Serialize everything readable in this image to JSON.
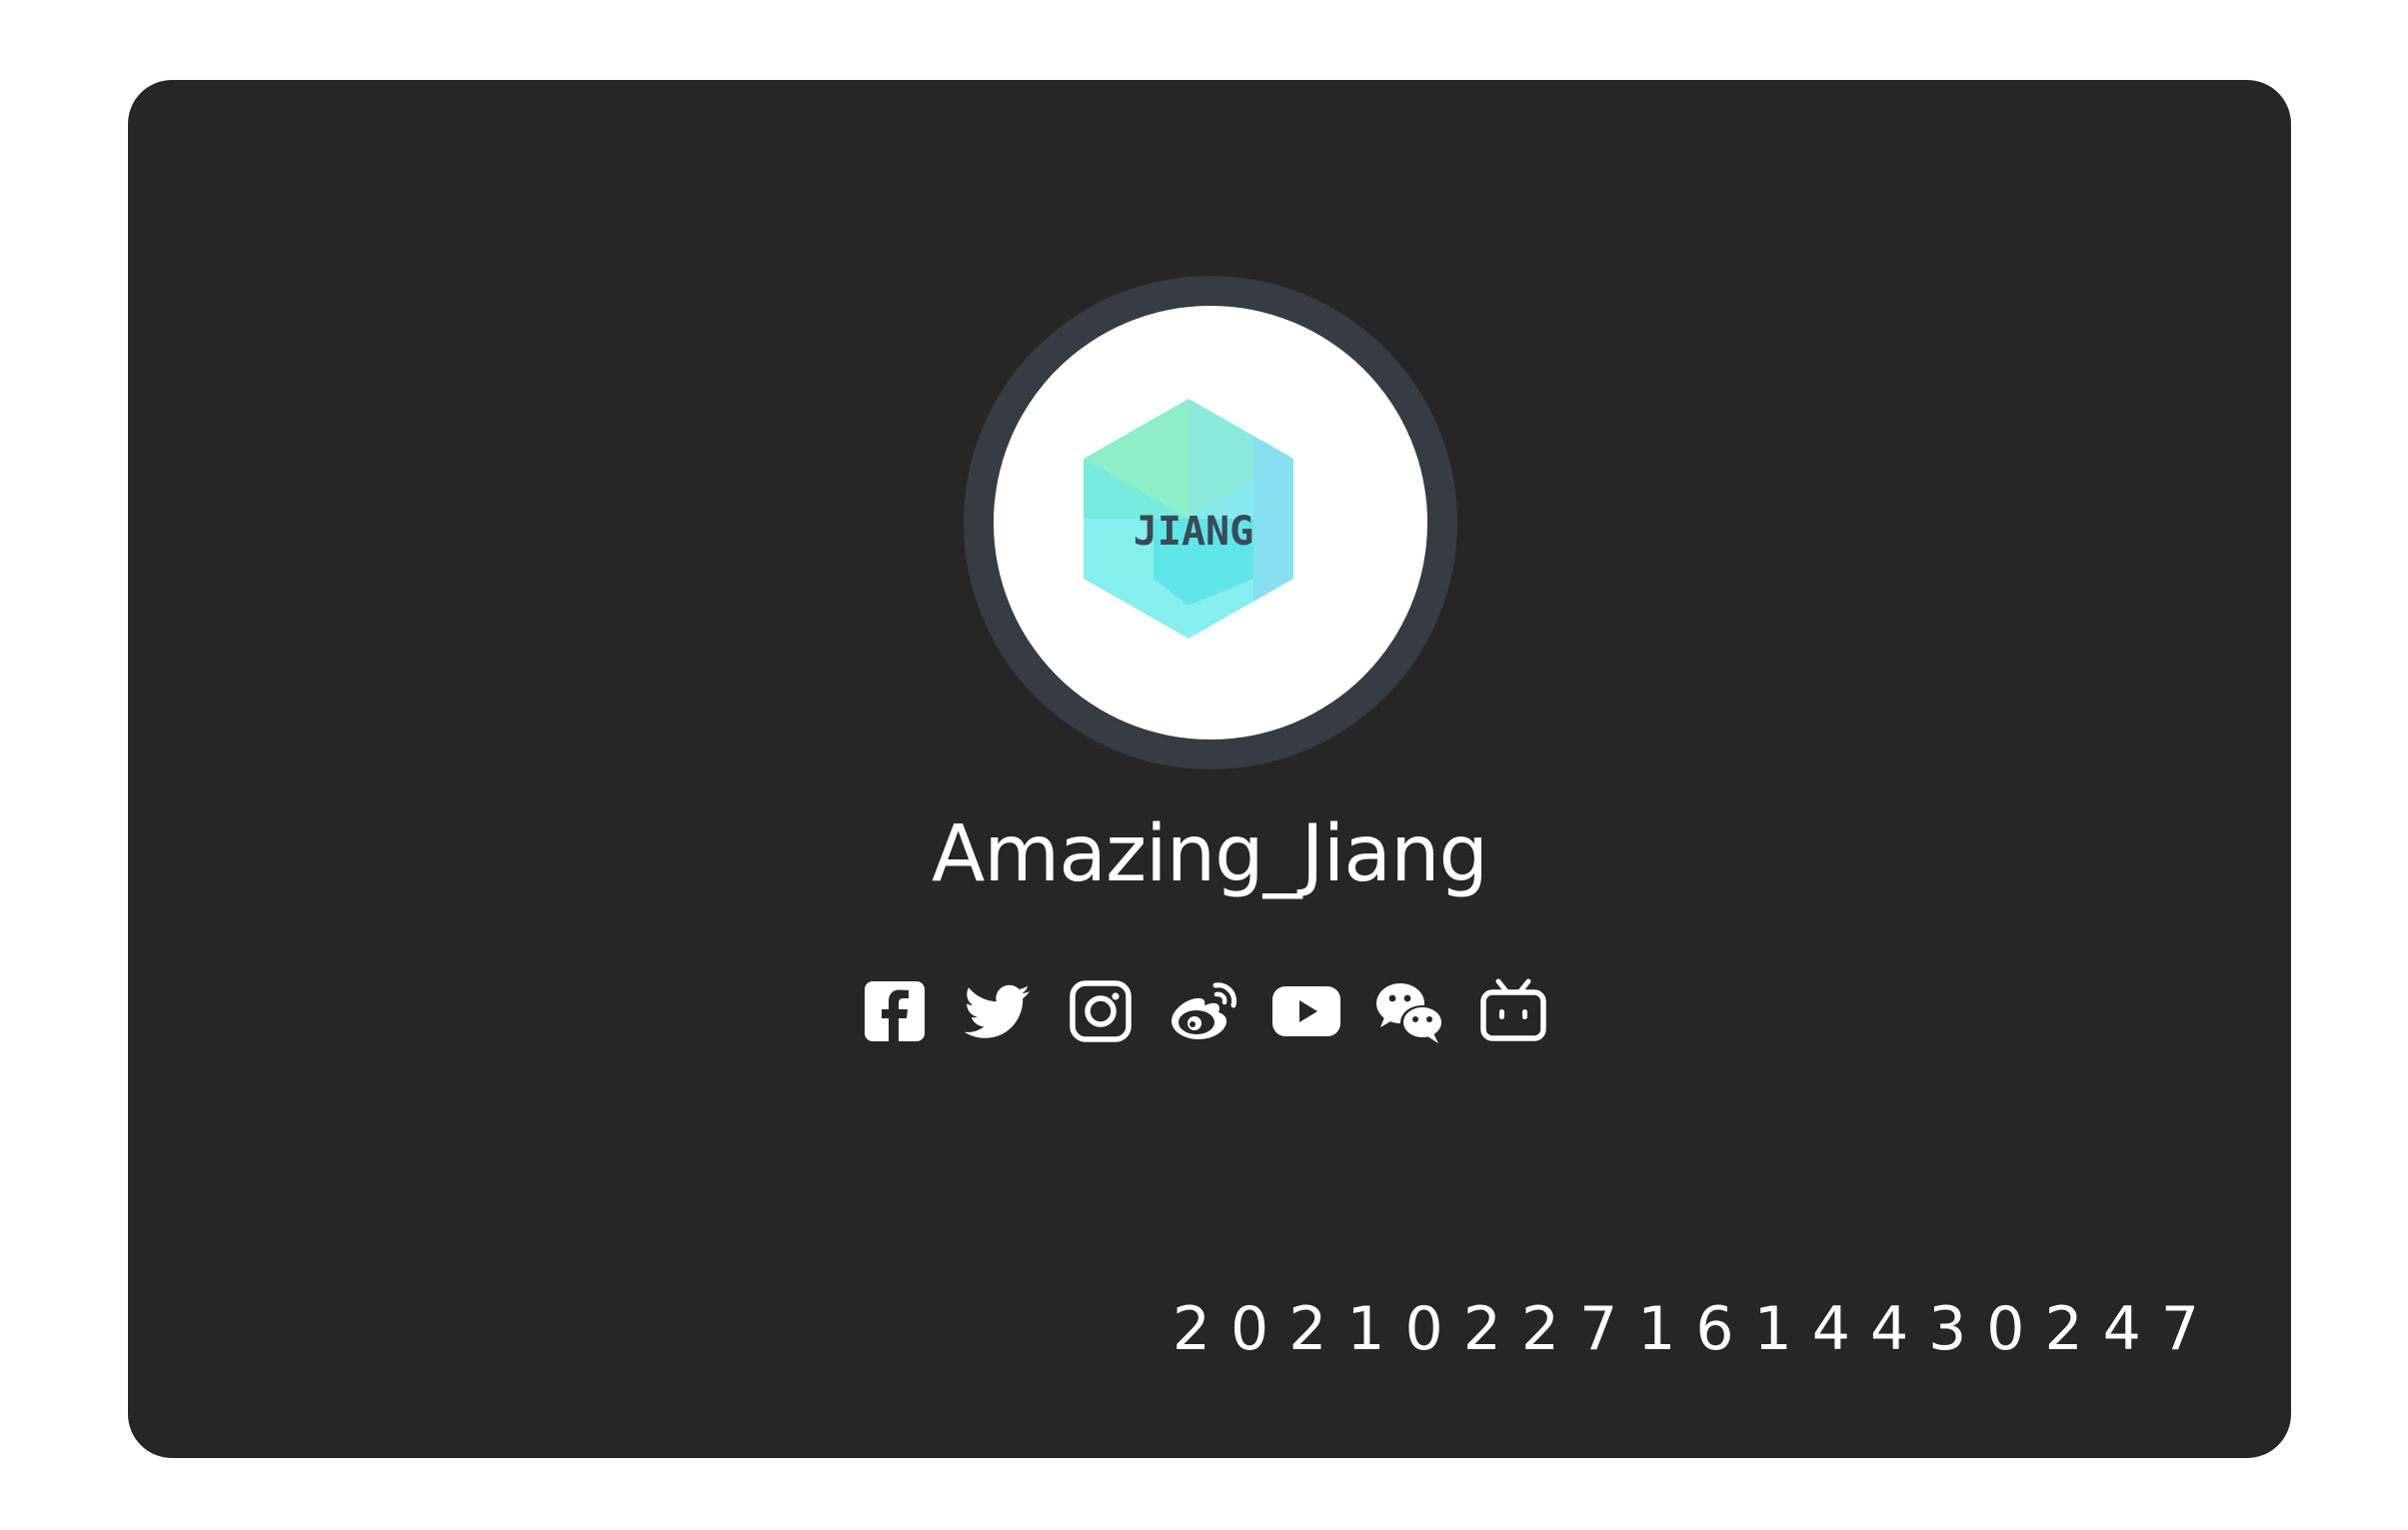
{
  "profile": {
    "username": "Amazing_Jiang",
    "logo_text": "JIANG",
    "serial_number": "202102271614430247"
  },
  "social_links": [
    {
      "icon": "facebook-icon"
    },
    {
      "icon": "twitter-icon"
    },
    {
      "icon": "instagram-icon"
    },
    {
      "icon": "weibo-icon"
    },
    {
      "icon": "youtube-icon"
    },
    {
      "icon": "wechat-icon"
    },
    {
      "icon": "bilibili-icon"
    }
  ],
  "colors": {
    "card_background": "#262626",
    "avatar_ring": "#353c43",
    "text": "#ffffff",
    "logo_green": "#8ef0c6",
    "logo_cyan": "#88eff0",
    "logo_blue": "#86e0f0",
    "logo_text": "#3c4a55"
  }
}
